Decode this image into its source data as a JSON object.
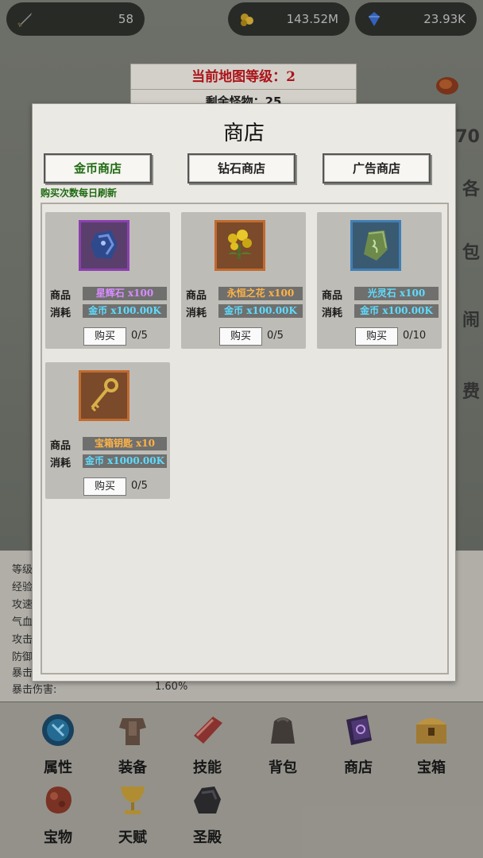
{
  "topbar": {
    "level": "58",
    "gold": "143.52M",
    "diamonds": "23.93K"
  },
  "map": {
    "level_text": "当前地图等级：2",
    "monsters_text": "剩余怪物：25"
  },
  "side_hints": [
    "70",
    "各",
    "包",
    "闹",
    "费"
  ],
  "stats": {
    "rows": [
      {
        "label": "等级",
        "value": ""
      },
      {
        "label": "经验",
        "value": ""
      },
      {
        "label": "攻速",
        "value": ""
      },
      {
        "label": "气血",
        "value": ""
      },
      {
        "label": "攻击",
        "value": ""
      },
      {
        "label": "防御",
        "value": ""
      },
      {
        "label": "暴击",
        "value": ""
      },
      {
        "label": "暴击伤害:",
        "value": "1.60%"
      }
    ]
  },
  "shop": {
    "title": "商店",
    "tabs": [
      {
        "label": "金币商店",
        "active": true
      },
      {
        "label": "钻石商店",
        "active": false
      },
      {
        "label": "广告商店",
        "active": false
      }
    ],
    "refresh_note": "购买次数每日刷新",
    "item_label": "商品",
    "cost_label": "消耗",
    "buy_label": "购买",
    "items": [
      {
        "name": "星辉石 x100",
        "cost": "金币 x100.00K",
        "count": "0/5",
        "icon": "star-stone-icon",
        "name_color": "#d88cff",
        "frame_color": "#8c3fb0"
      },
      {
        "name": "永恒之花 x100",
        "cost": "金币 x100.00K",
        "count": "0/5",
        "icon": "eternal-flower-icon",
        "name_color": "#ffb347",
        "frame_color": "#c26a2f"
      },
      {
        "name": "光灵石 x100",
        "cost": "金币 x100.00K",
        "count": "0/10",
        "icon": "light-spirit-stone-icon",
        "name_color": "#5fdcff",
        "frame_color": "#3f7fb5"
      },
      {
        "name": "宝箱钥匙 x10",
        "cost": "金币 x1000.00K",
        "count": "0/5",
        "icon": "chest-key-icon",
        "name_color": "#ffb347",
        "frame_color": "#c26a2f"
      }
    ],
    "cost_color": "#5fdcff"
  },
  "nav": [
    {
      "label": "属性",
      "icon": "attribute-orb-icon"
    },
    {
      "label": "装备",
      "icon": "armor-icon"
    },
    {
      "label": "技能",
      "icon": "skill-scroll-icon"
    },
    {
      "label": "背包",
      "icon": "backpack-icon"
    },
    {
      "label": "商店",
      "icon": "shop-book-icon"
    },
    {
      "label": "宝箱",
      "icon": "treasure-chest-icon"
    },
    {
      "label": "宝物",
      "icon": "treasure-ore-icon"
    },
    {
      "label": "天赋",
      "icon": "talent-goblet-icon"
    },
    {
      "label": "圣殿",
      "icon": "temple-rock-icon"
    }
  ]
}
